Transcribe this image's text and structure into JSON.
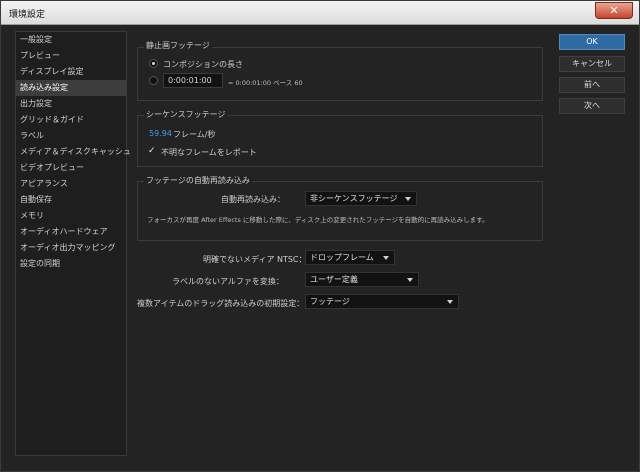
{
  "window": {
    "title": "環境設定",
    "close_symbol": "✕"
  },
  "sidebar": {
    "items": [
      "一般設定",
      "プレビュー",
      "ディスプレイ設定",
      "読み込み設定",
      "出力設定",
      "グリッド＆ガイド",
      "ラベル",
      "メディア＆ディスクキャッシュ",
      "ビデオプレビュー",
      "アピアランス",
      "自動保存",
      "メモリ",
      "オーディオハードウェア",
      "オーディオ出力マッピング",
      "設定の同期"
    ],
    "selected_index": 3
  },
  "still": {
    "title": "静止画フッテージ",
    "option1": "コンポジションの長さ",
    "timecode": "0:00:01:00",
    "equals_text": "= 0:00:01:00 ベース 60"
  },
  "sequence": {
    "title": "シーケンスフッテージ",
    "fps_value": "59.94",
    "fps_unit": "フレーム/秒",
    "report_check": "✓",
    "report_label": "不明なフレームをレポート"
  },
  "autoreload": {
    "title": "フッテージの自動再読み込み",
    "label": "自動再読み込み：",
    "value": "非シーケンスフッテージ",
    "note": "フォーカスが再度 After Effects に移動した際に、ディスク上の変更されたフッテージを自動的に再読み込みします。"
  },
  "fields": {
    "ntsc_label": "明確でないメディア NTSC：",
    "ntsc_value": "ドロップフレーム",
    "alpha_label": "ラベルのないアルファを変換：",
    "alpha_value": "ユーザー定義",
    "drag_label": "複数アイテムのドラッグ読み込みの初期設定：",
    "drag_value": "フッテージ"
  },
  "buttons": {
    "ok": "OK",
    "cancel": "キャンセル",
    "prev": "前へ",
    "next": "次へ"
  }
}
